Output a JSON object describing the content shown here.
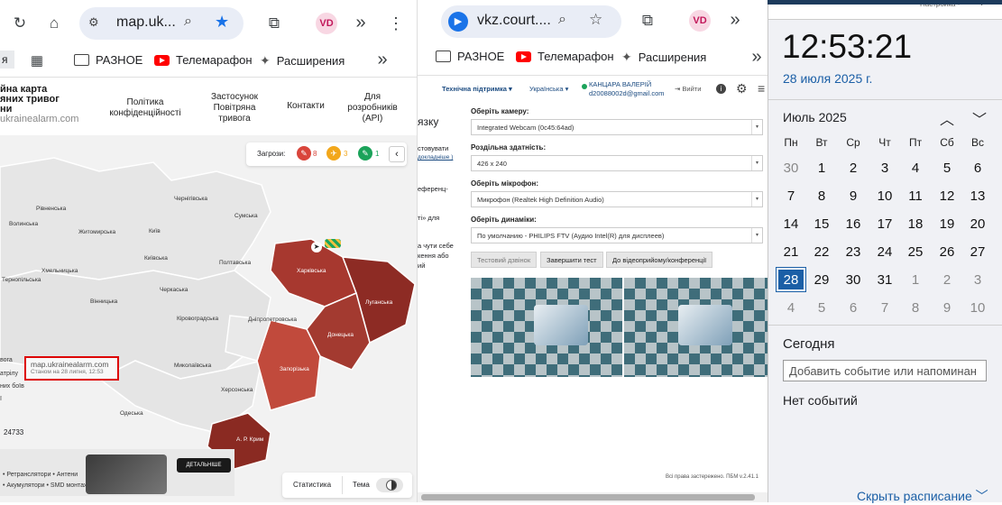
{
  "left_browser": {
    "url": "map.uk...",
    "bookmarks": {
      "prefix": "я",
      "b1": "РАЗНОЕ",
      "b2": "Телемарафон",
      "b3": "Расширения"
    },
    "avatar": "VD",
    "site_nav": {
      "logo_l1": "йна карта",
      "logo_l2": "яних тривог",
      "logo_l3": "ни",
      "logo_url": "ukrainealarm.com",
      "policy": "Політика конфіденційності",
      "app": "Застосунок Повітряна тривога",
      "contacts": "Контакти",
      "devs": "Для розробників (API)"
    },
    "threats": {
      "label": "Загрози:",
      "c1": "8",
      "c2": "3",
      "c3": "1"
    },
    "regions": [
      "Рівненська",
      "Волинська",
      "Житомирська",
      "Київ",
      "Київська",
      "Чернігівська",
      "Сумська",
      "Хмельницька",
      "Вінницька",
      "Тернопільська",
      "Черкаська",
      "Полтавська",
      "Харківська",
      "Луганська",
      "Кіровоградська",
      "Дніпропетровська",
      "Донецька",
      "Миколаївська",
      "Запорізька",
      "Херсонська",
      "Одеська",
      "А. Р. Крим"
    ],
    "stamp": {
      "url": "map.ukrainealarm.com",
      "sub": "Станом на 28 липня, 12:53"
    },
    "legend_fragments": [
      "вога",
      "атрілу",
      "них боїв",
      "ї"
    ],
    "count": "24733",
    "ad": {
      "line1": "• Ретранслятори • Антени",
      "line2": "• Акумулятори • SMD монтаж",
      "btn": "ДЕТАЛЬНІШЕ"
    },
    "footer": {
      "stats": "Статистика",
      "theme": "Тема"
    }
  },
  "mid_browser": {
    "url": "vkz.court....",
    "avatar": "VD",
    "bookmarks": {
      "b1": "РАЗНОЕ",
      "b2": "Телемарафон",
      "b3": "Расширения"
    },
    "topbar": {
      "support": "Технічна підтримка",
      "lang": "Українська",
      "user_name": "КАНЦАРА ВАЛЕРІЙ",
      "user_email": "d20088002d@gmail.com",
      "exit": "Вийти"
    },
    "side_fragments": [
      "язку",
      "стовувати",
      "докладніше )",
      "еференц-",
      "ті» для",
      "а чути себе",
      "кення або",
      "ий"
    ],
    "form": {
      "camera_label": "Оберіть камеру:",
      "camera_value": "Integrated Webcam (0c45:64ad)",
      "res_label": "Роздільна здатність:",
      "res_value": "426 x 240",
      "mic_label": "Оберіть мікрофон:",
      "mic_value": "Микрофон (Realtek High Definition Audio)",
      "spk_label": "Оберіть динаміки:",
      "spk_value": "По умолчанию - PHILIPS FTV (Аудио Intel(R) для дисплеев)"
    },
    "buttons": {
      "test_call": "Тестовий дзвінок",
      "end_test": "Завершити тест",
      "to_conf": "До відеоприйому/конференції"
    },
    "footer": "Всі права застережено. ПБМ v.2.41.1"
  },
  "calendar": {
    "time": "12:53:21",
    "date": "28 июля 2025 г.",
    "month": "Июль 2025",
    "weekdays": [
      "Пн",
      "Вт",
      "Ср",
      "Чт",
      "Пт",
      "Сб",
      "Вс"
    ],
    "weeks": [
      [
        "30",
        "1",
        "2",
        "3",
        "4",
        "5",
        "6"
      ],
      [
        "7",
        "8",
        "9",
        "10",
        "11",
        "12",
        "13"
      ],
      [
        "14",
        "15",
        "16",
        "17",
        "18",
        "19",
        "20"
      ],
      [
        "21",
        "22",
        "23",
        "24",
        "25",
        "26",
        "27"
      ],
      [
        "28",
        "29",
        "30",
        "31",
        "1",
        "2",
        "3"
      ],
      [
        "4",
        "5",
        "6",
        "7",
        "8",
        "9",
        "10"
      ]
    ],
    "today_label": "Сегодня",
    "event_placeholder": "Добавить событие или напоминан",
    "no_events": "Нет событий",
    "show_schedule": "Скрыть расписание",
    "top_settings": "Настройка"
  }
}
